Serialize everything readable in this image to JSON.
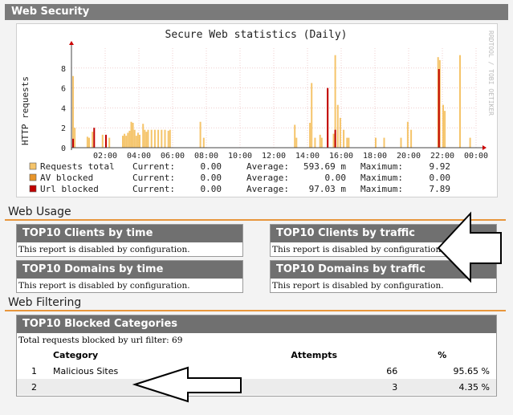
{
  "web_security": {
    "title": "Web Security",
    "chart_data": {
      "type": "bar",
      "title": "Secure Web statistics (Daily)",
      "ylabel": "HTTP requests",
      "watermark": "RRDTOOL / TOBI OETIKER",
      "ylim": [
        0,
        10
      ],
      "yticks": [
        "0",
        "2",
        "4",
        "6",
        "8"
      ],
      "xticks": [
        "02:00",
        "04:00",
        "06:00",
        "08:00",
        "10:00",
        "12:00",
        "14:00",
        "16:00",
        "18:00",
        "20:00",
        "22:00",
        "00:00"
      ],
      "grid": true,
      "x_unit_hours": true,
      "series": [
        {
          "name": "Requests total",
          "color": "#f5c46a",
          "bars": [
            [
              0.05,
              7.2
            ],
            [
              0.15,
              2.0
            ],
            [
              0.9,
              1.1
            ],
            [
              1.0,
              1.0
            ],
            [
              1.2,
              1.6
            ],
            [
              1.8,
              1.3
            ],
            [
              2.0,
              0.7
            ],
            [
              2.2,
              1.0
            ],
            [
              3.0,
              1.2
            ],
            [
              3.1,
              1.4
            ],
            [
              3.2,
              1.2
            ],
            [
              3.3,
              1.5
            ],
            [
              3.4,
              1.7
            ],
            [
              3.5,
              2.6
            ],
            [
              3.6,
              2.5
            ],
            [
              3.7,
              1.8
            ],
            [
              3.8,
              1.2
            ],
            [
              3.9,
              1.5
            ],
            [
              4.0,
              1.3
            ],
            [
              4.2,
              2.4
            ],
            [
              4.3,
              1.8
            ],
            [
              4.4,
              1.6
            ],
            [
              4.5,
              1.8
            ],
            [
              4.7,
              1.8
            ],
            [
              4.9,
              1.8
            ],
            [
              5.1,
              1.8
            ],
            [
              5.3,
              1.8
            ],
            [
              5.5,
              1.8
            ],
            [
              5.7,
              1.7
            ],
            [
              5.8,
              1.8
            ],
            [
              7.6,
              2.6
            ],
            [
              7.8,
              1.0
            ],
            [
              13.2,
              2.3
            ],
            [
              13.3,
              1.0
            ],
            [
              14.1,
              2.5
            ],
            [
              14.2,
              6.5
            ],
            [
              14.4,
              1.0
            ],
            [
              14.7,
              1.3
            ],
            [
              14.8,
              1.0
            ],
            [
              15.15,
              5.8
            ],
            [
              15.5,
              1.4
            ],
            [
              15.6,
              9.3
            ],
            [
              15.75,
              4.3
            ],
            [
              15.9,
              3.0
            ],
            [
              16.1,
              1.8
            ],
            [
              16.3,
              1.0
            ],
            [
              16.4,
              1.0
            ],
            [
              18.0,
              1.0
            ],
            [
              18.5,
              1.0
            ],
            [
              19.5,
              1.0
            ],
            [
              19.9,
              2.6
            ],
            [
              20.1,
              1.8
            ],
            [
              21.7,
              9.1
            ],
            [
              21.8,
              8.8
            ],
            [
              22.0,
              4.3
            ],
            [
              22.1,
              3.7
            ],
            [
              23.0,
              9.3
            ],
            [
              23.6,
              1.0
            ]
          ]
        },
        {
          "name": "AV blocked",
          "color": "#e8952a",
          "bars": []
        },
        {
          "name": "Url blocked",
          "color": "#c00000",
          "bars": [
            [
              0.05,
              0.9
            ],
            [
              1.3,
              2.0
            ],
            [
              2.0,
              1.3
            ],
            [
              15.15,
              6.0
            ],
            [
              15.6,
              1.8
            ],
            [
              21.75,
              7.9
            ]
          ]
        }
      ]
    },
    "legend": [
      {
        "name": "Requests total",
        "color": "#f5c46a",
        "current_label": "Current:",
        "current": "0.00",
        "average_label": "Average:",
        "average": "593.69 m",
        "maximum_label": "Maximum:",
        "maximum": "9.92"
      },
      {
        "name": "AV blocked",
        "color": "#e8952a",
        "current_label": "Current:",
        "current": "0.00",
        "average_label": "Average:",
        "average": "0.00",
        "maximum_label": "Maximum:",
        "maximum": "0.00"
      },
      {
        "name": "Url blocked",
        "color": "#c00000",
        "current_label": "Current:",
        "current": "0.00",
        "average_label": "Average:",
        "average": "97.03 m",
        "maximum_label": "Maximum:",
        "maximum": "7.89"
      }
    ]
  },
  "web_usage": {
    "title": "Web Usage",
    "boxes": [
      {
        "title": "TOP10 Clients by time",
        "message": "This report is disabled by configuration."
      },
      {
        "title": "TOP10 Clients by traffic",
        "message": "This report is disabled by configuration."
      },
      {
        "title": "TOP10 Domains by time",
        "message": "This report is disabled by configuration."
      },
      {
        "title": "TOP10 Domains by traffic",
        "message": "This report is disabled by configuration."
      }
    ]
  },
  "web_filtering": {
    "title": "Web Filtering",
    "box_title": "TOP10 Blocked Categories",
    "total_text": "Total requests blocked by url filter: 69",
    "columns": [
      "Category",
      "Attempts",
      "%"
    ],
    "rows": [
      {
        "rank": "1",
        "category": "Malicious Sites",
        "attempts": "66",
        "percent": "95.65 %"
      },
      {
        "rank": "2",
        "category": "",
        "attempts": "3",
        "percent": "4.35 %"
      }
    ]
  },
  "annotations": {
    "arrow_color": "#000000"
  }
}
